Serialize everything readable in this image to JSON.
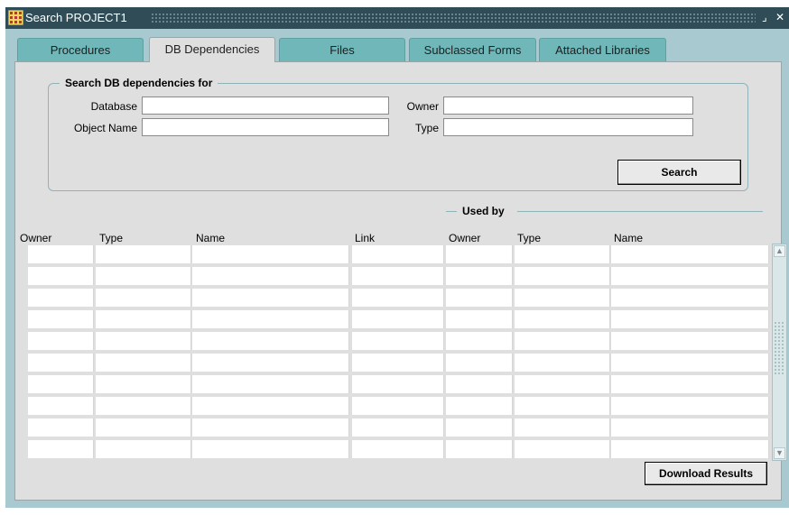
{
  "window": {
    "title": "Search PROJECT1",
    "title_buttons": [
      "⌟",
      "✕"
    ]
  },
  "tabs": [
    {
      "label": "Procedures",
      "active": false
    },
    {
      "label": "DB Dependencies",
      "active": true
    },
    {
      "label": "Files",
      "active": false
    },
    {
      "label": "Subclassed Forms",
      "active": false
    },
    {
      "label": "Attached Libraries",
      "active": false
    }
  ],
  "search": {
    "group_title": "Search DB dependencies for",
    "database_label": "Database",
    "database_value": "",
    "owner_label": "Owner",
    "owner_value": "",
    "object_name_label": "Object Name",
    "object_name_value": "",
    "type_label": "Type",
    "type_value": "",
    "search_button": "Search"
  },
  "results": {
    "used_by_label": "Used by",
    "columns": [
      "Owner",
      "Type",
      "Name",
      "Link",
      "Owner",
      "Type",
      "Name"
    ],
    "row_count": 10
  },
  "download_button": "Download Results"
}
